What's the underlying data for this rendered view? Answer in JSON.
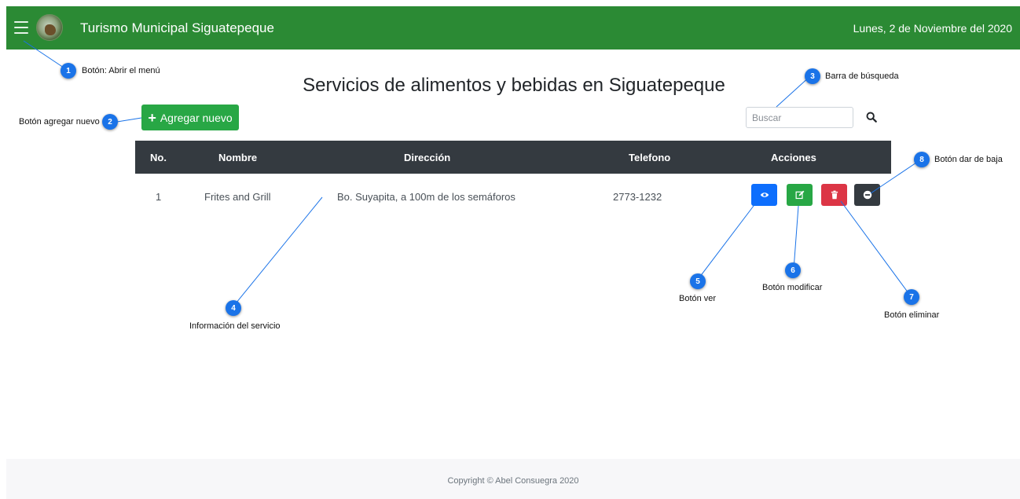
{
  "app": {
    "title": "Turismo Municipal Siguatepeque",
    "date": "Lunes, 2 de Noviembre del 2020"
  },
  "page": {
    "title": "Servicios de alimentos y bebidas en Siguatepeque"
  },
  "toolbar": {
    "add_label": "Agregar nuevo",
    "search_placeholder": "Buscar"
  },
  "table": {
    "headers": [
      "No.",
      "Nombre",
      "Dirección",
      "Telefono",
      "Acciones"
    ],
    "rows": [
      [
        "1",
        "Frites and Grill",
        "Bo. Suyapita, a 100m de los semáforos",
        "2773-1232"
      ]
    ]
  },
  "footer": {
    "copyright": "Copyright © Abel Consuegra 2020"
  },
  "callouts": {
    "c1": {
      "num": "1",
      "label": "Botón: Abrir el menú"
    },
    "c2": {
      "num": "2",
      "label": "Botón agregar nuevo"
    },
    "c3": {
      "num": "3",
      "label": "Barra de búsqueda"
    },
    "c4": {
      "num": "4",
      "label": "Información del servicio"
    },
    "c5": {
      "num": "5",
      "label": "Botón ver"
    },
    "c6": {
      "num": "6",
      "label": "Botón modificar"
    },
    "c7": {
      "num": "7",
      "label": "Botón eliminar"
    },
    "c8": {
      "num": "8",
      "label": "Botón dar de baja"
    }
  },
  "colors": {
    "topbar": "#2b8a34",
    "add_button": "#28a745",
    "view_button": "#0d6efd",
    "edit_button": "#28a745",
    "delete_button": "#dc3545",
    "disable_button": "#343a40",
    "table_header": "#343a40",
    "callout_badge": "#1a73e8"
  },
  "icons": {
    "menu": "hamburger-icon",
    "search": "search-icon",
    "view": "eye-icon",
    "edit": "edit-icon",
    "delete": "trash-icon",
    "disable": "minus-circle-icon"
  }
}
